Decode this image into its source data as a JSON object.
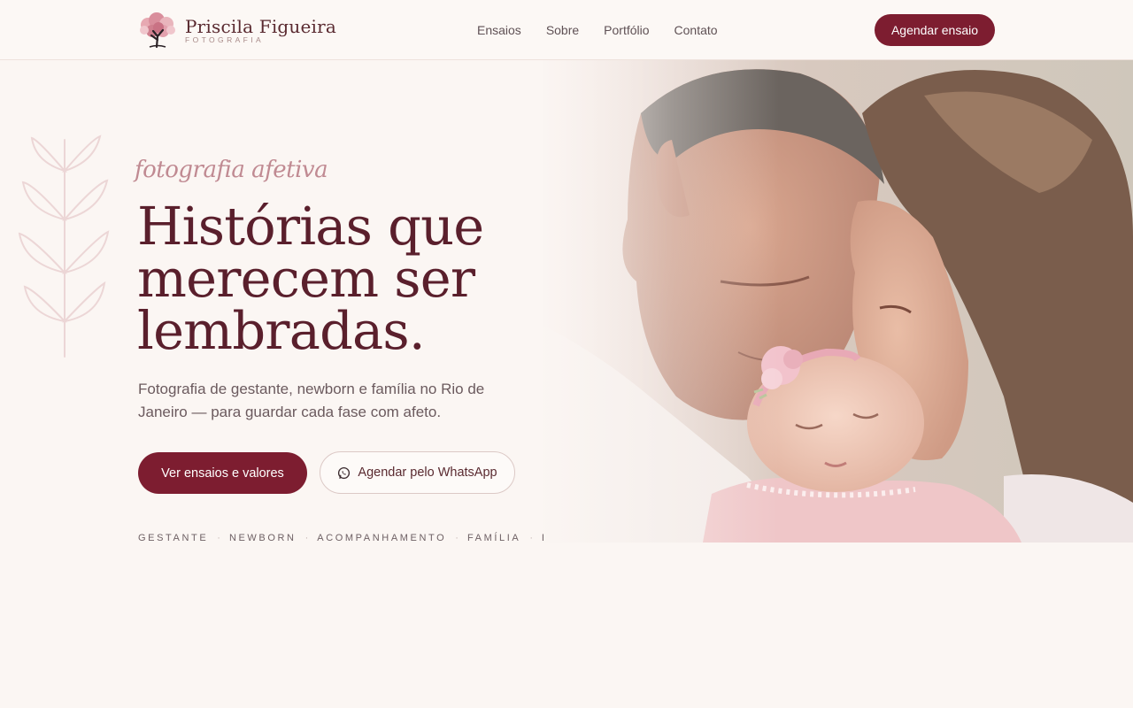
{
  "brand": {
    "name": "Priscila Figueira",
    "tagline": "FOTOGRAFIA",
    "logo_icon": "tree-logo-icon"
  },
  "nav": {
    "items": [
      "Ensaios",
      "Sobre",
      "Portfólio",
      "Contato"
    ],
    "cta": "Agendar ensaio"
  },
  "hero": {
    "script": "fotografia afetiva",
    "title_lines": [
      "Histórias que",
      "merecem ser",
      "lembradas."
    ],
    "description": "Fotografia de gestante, newborn e família no Rio de Janeiro — para guardar cada fase com afeto.",
    "primary_button": "Ver ensaios e valores",
    "secondary_button": "Agendar pelo WhatsApp",
    "secondary_icon": "whatsapp-icon",
    "photo_icon": "family-photo",
    "services": [
      "GESTANTE",
      "NEWBORN",
      "ACOMPANHAMENTO",
      "FAMÍLIA",
      "EVENTOS"
    ],
    "separator": "·"
  },
  "colors": {
    "accent": "#7d1d30",
    "heading": "#5a1f2c",
    "script": "#c08a92",
    "background": "#fbf6f3",
    "leaf_decoration": "#ecd6d6"
  }
}
